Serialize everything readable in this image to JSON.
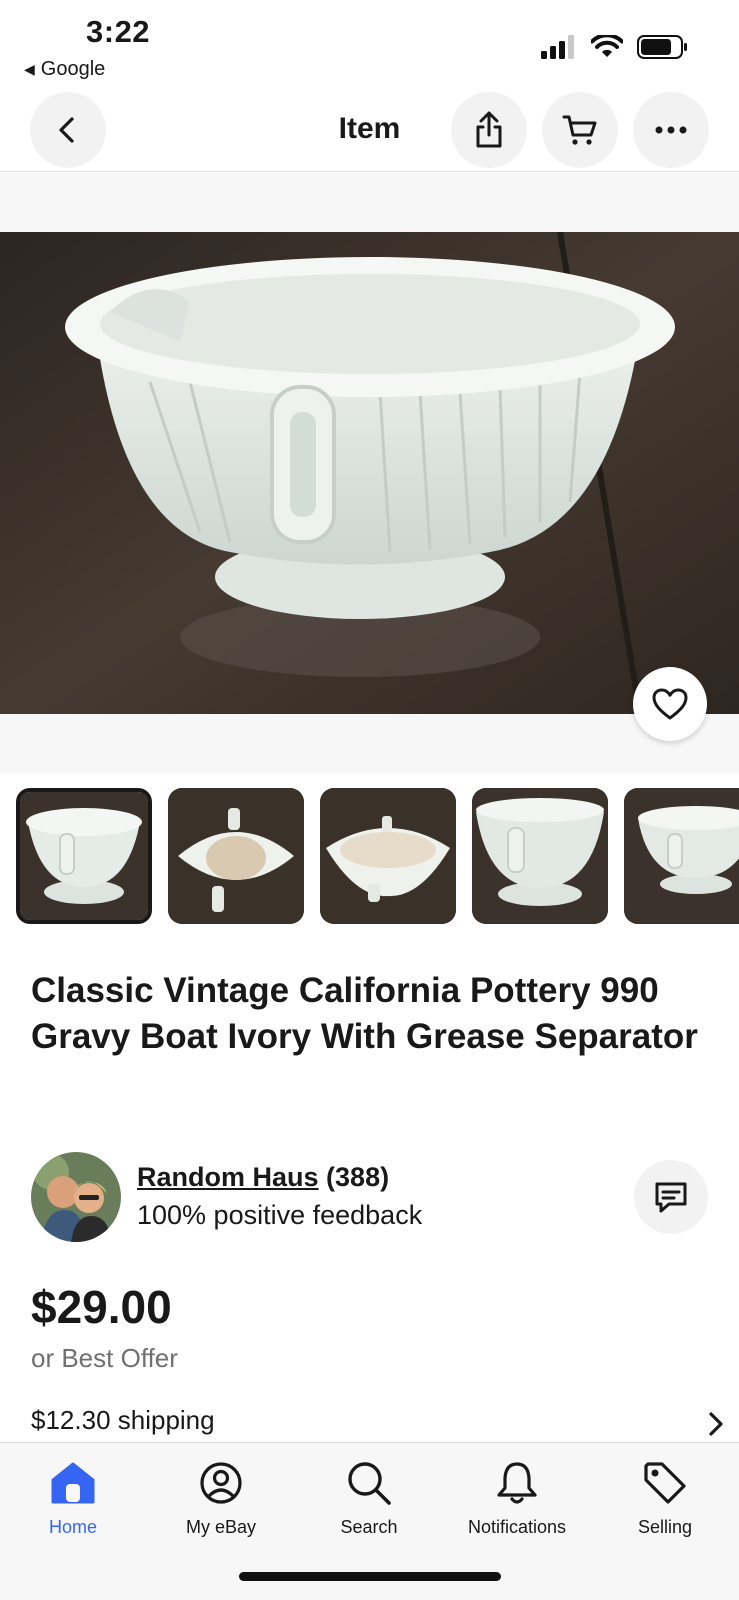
{
  "status_bar": {
    "time": "3:22",
    "back_app": "Google"
  },
  "header": {
    "title": "Item",
    "back_icon": "chevron-left-icon",
    "share_icon": "share-icon",
    "cart_icon": "cart-icon",
    "more_icon": "more-icon"
  },
  "gallery": {
    "thumbnail_count": 5,
    "selected_index": 0,
    "favorite_icon": "heart-icon"
  },
  "listing": {
    "title": "Classic Vintage California Pottery 990 Gravy Boat Ivory With Grease Separator"
  },
  "seller": {
    "name": "Random Haus",
    "rating_count": "(388)",
    "feedback": "100% positive feedback",
    "message_icon": "message-icon"
  },
  "pricing": {
    "price": "$29.00",
    "best_offer": "or Best Offer",
    "shipping": "$12.30 shipping"
  },
  "tabbar": {
    "tabs": [
      {
        "label": "Home",
        "icon": "home-icon",
        "active": true
      },
      {
        "label": "My eBay",
        "icon": "user-icon",
        "active": false
      },
      {
        "label": "Search",
        "icon": "search-icon",
        "active": false
      },
      {
        "label": "Notifications",
        "icon": "bell-icon",
        "active": false
      },
      {
        "label": "Selling",
        "icon": "tag-icon",
        "active": false
      }
    ]
  },
  "colors": {
    "accent": "#3665f3",
    "text": "#191919",
    "muted": "#707070",
    "table_wood": "#3a3129",
    "pottery": "#e9ede8"
  }
}
